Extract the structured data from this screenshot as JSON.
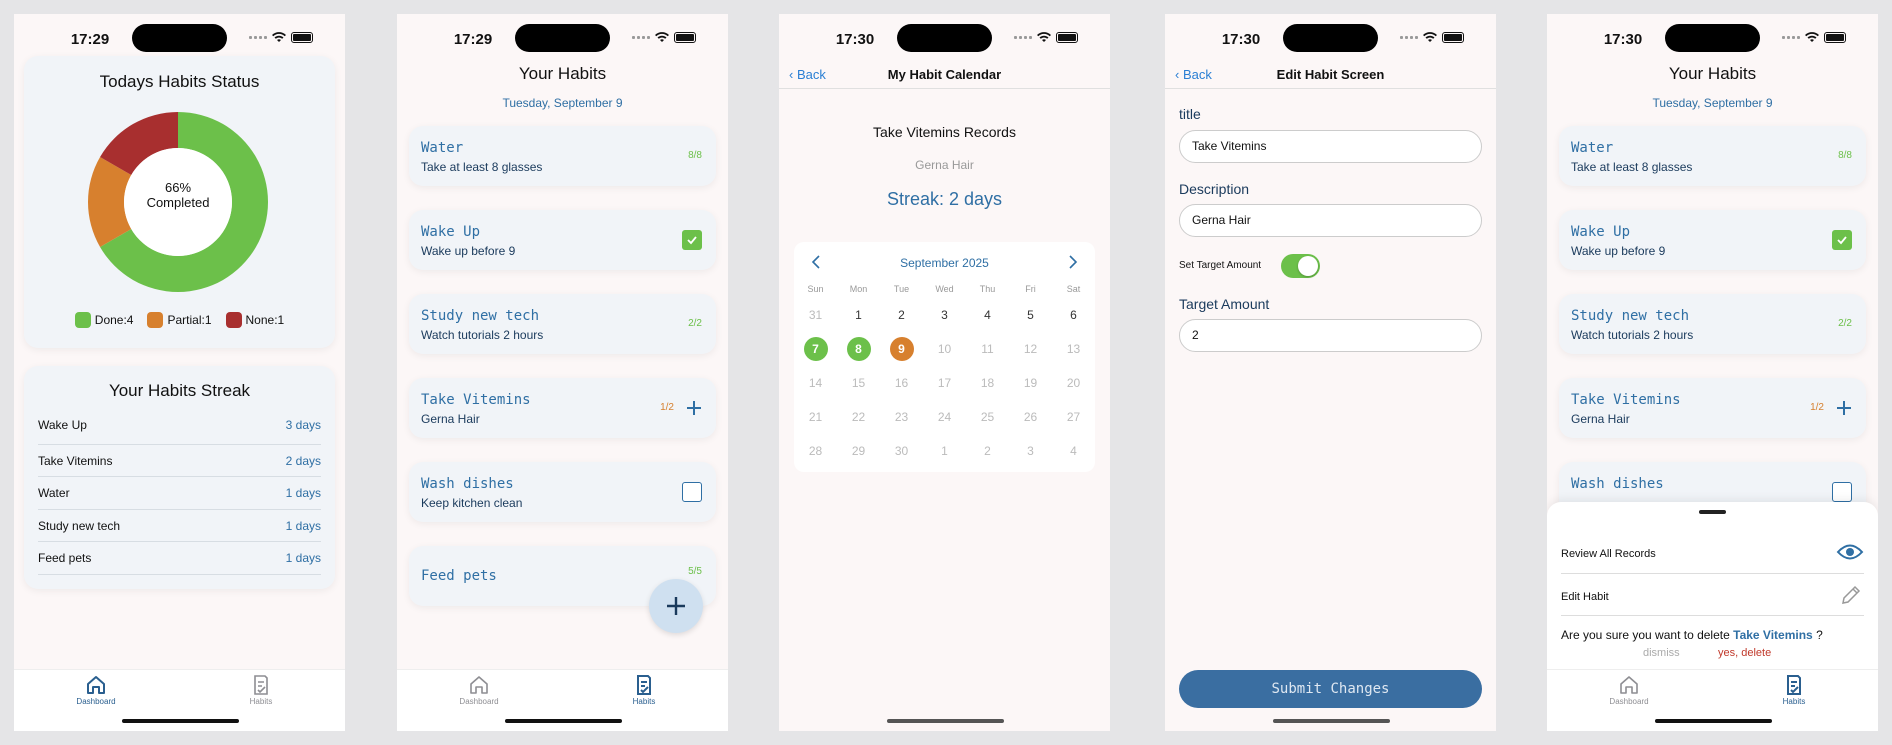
{
  "colors": {
    "accent": "#2f6fa4",
    "done": "#6cc04a",
    "partial": "#d7802e",
    "none": "#a82f2f",
    "destructive": "#c0392b"
  },
  "dashboard": {
    "time": "17:29",
    "status_title": "Todays Habits Status",
    "center_percent": "66%",
    "center_label": "Completed",
    "legend": [
      {
        "label": "Done:4",
        "color": "#6cc04a"
      },
      {
        "label": "Partial:1",
        "color": "#d7802e"
      },
      {
        "label": "None:1",
        "color": "#a82f2f"
      }
    ],
    "chart_data": {
      "type": "pie",
      "categories": [
        "Done",
        "Partial",
        "None"
      ],
      "values": [
        4,
        1,
        1
      ]
    },
    "streak_title": "Your Habits Streak",
    "streaks": [
      {
        "name": "Wake Up",
        "days": "3 days"
      },
      {
        "name": "Take Vitemins",
        "days": "2 days"
      },
      {
        "name": "Water",
        "days": "1 days"
      },
      {
        "name": "Study new tech",
        "days": "1 days"
      },
      {
        "name": "Feed pets",
        "days": "1 days"
      }
    ]
  },
  "tabs": {
    "dashboard": "Dashboard",
    "habits": "Habits"
  },
  "habits": {
    "time": "17:29",
    "title": "Your Habits",
    "date": "Tuesday, September 9",
    "items": [
      {
        "name": "Water",
        "desc": "Take at least 8 glasses",
        "count": "8/8"
      },
      {
        "name": "Wake Up",
        "desc": "Wake up before 9",
        "count": ""
      },
      {
        "name": "Study new tech",
        "desc": "Watch tutorials 2 hours",
        "count": "2/2"
      },
      {
        "name": "Take Vitemins",
        "desc": "Gerna Hair",
        "count": "1/2"
      },
      {
        "name": "Wash dishes",
        "desc": "Keep kitchen clean",
        "count": ""
      },
      {
        "name": "Feed pets",
        "desc": "",
        "count": "5/5"
      }
    ]
  },
  "calendar": {
    "time": "17:30",
    "back": "Back",
    "nav_title": "My Habit Calendar",
    "records_title": "Take Vitemins  Records",
    "subtitle": "Gerna Hair",
    "streak": "Streak: 2 days",
    "month": "September 2025",
    "weekdays": [
      "Sun",
      "Mon",
      "Tue",
      "Wed",
      "Thu",
      "Fri",
      "Sat"
    ],
    "weeks": [
      [
        "31",
        "1",
        "2",
        "3",
        "4",
        "5",
        "6"
      ],
      [
        "7",
        "8",
        "9",
        "10",
        "11",
        "12",
        "13"
      ],
      [
        "14",
        "15",
        "16",
        "17",
        "18",
        "19",
        "20"
      ],
      [
        "21",
        "22",
        "23",
        "24",
        "25",
        "26",
        "27"
      ],
      [
        "28",
        "29",
        "30",
        "1",
        "2",
        "3",
        "4"
      ]
    ]
  },
  "edit": {
    "time": "17:30",
    "back": "Back",
    "nav_title": "Edit Habit Screen",
    "title_label": "title",
    "title_value": "Take Vitemins",
    "desc_label": "Description",
    "desc_value": "Gerna Hair",
    "toggle_label": "Set Target Amount",
    "target_label": "Target Amount",
    "target_value": "2",
    "submit": "Submit Changes"
  },
  "sheet": {
    "time": "17:30",
    "review": "Review All Records",
    "edit": "Edit Habit",
    "confirm_prefix": "Are you sure you want to delete",
    "confirm_name": "Take Vitemins",
    "confirm_suffix": "?",
    "dismiss": "dismiss",
    "delete": "yes, delete"
  }
}
